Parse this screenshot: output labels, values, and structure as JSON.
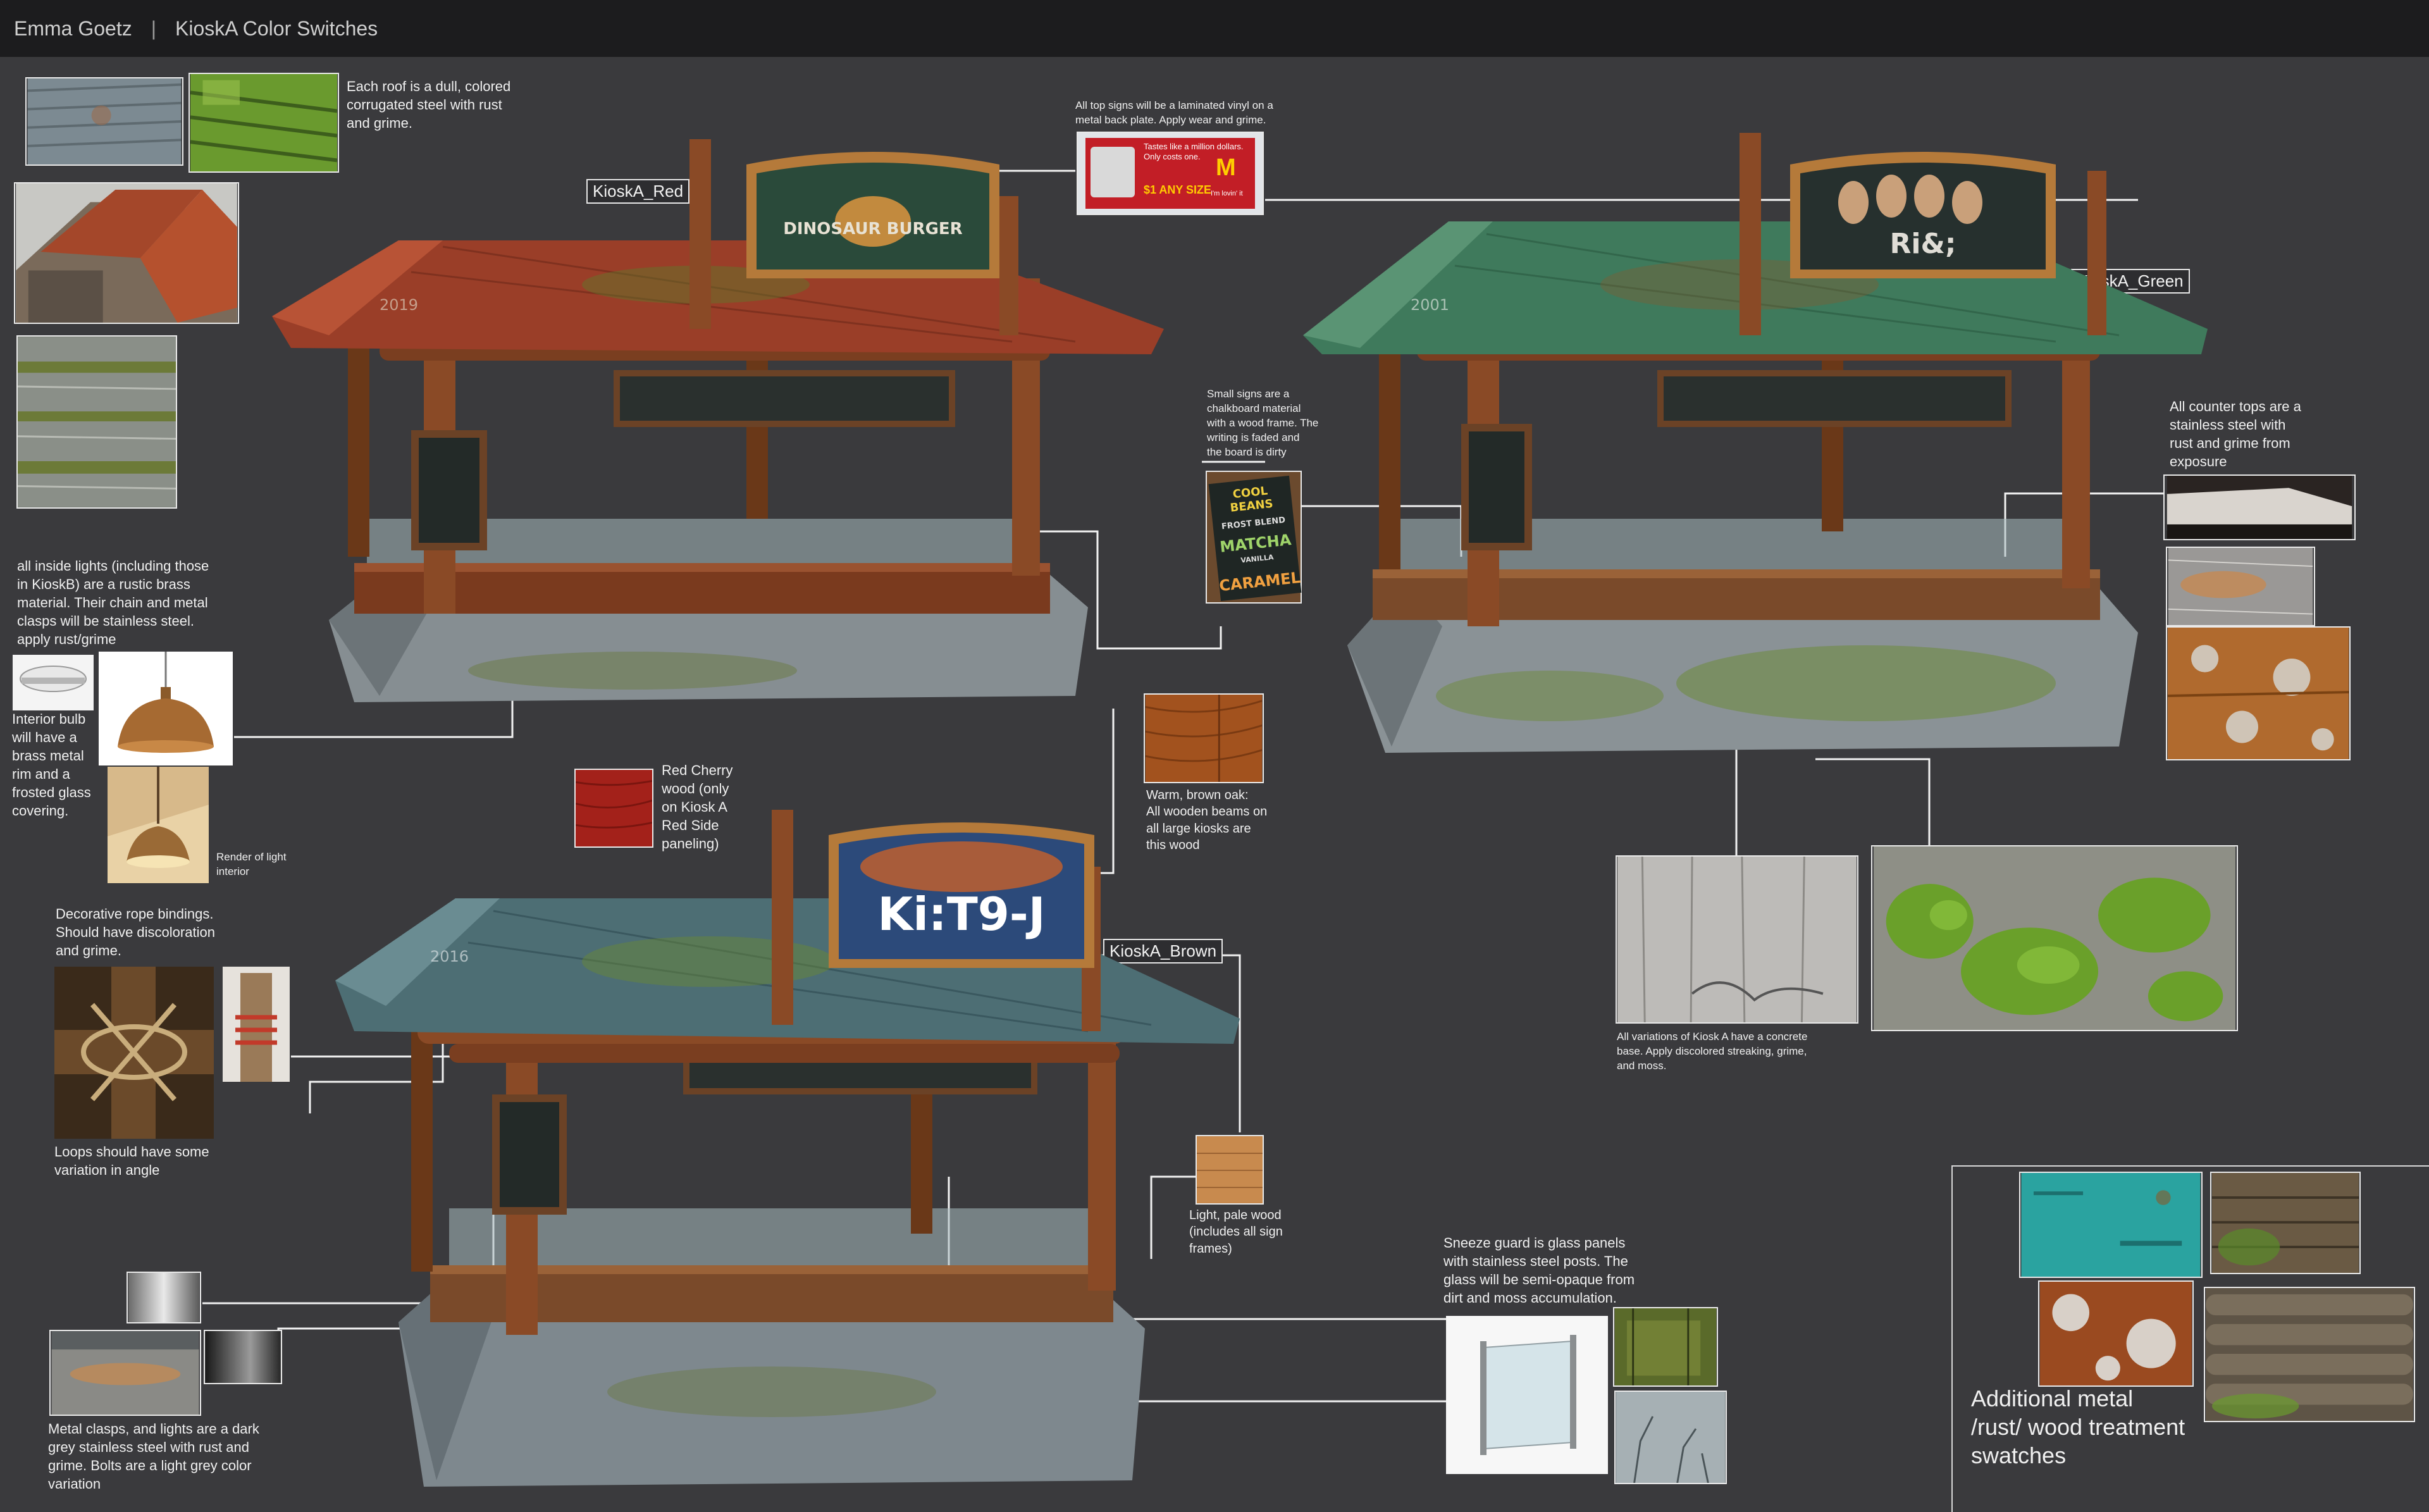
{
  "header": {
    "author": "Emma Goetz",
    "separator": "|",
    "title": "KioskA Color Switches"
  },
  "kiosk_labels": {
    "red": "KioskA_Red",
    "green": "KioskA_Green",
    "brown": "KioskA_Brown"
  },
  "notes": {
    "roof": "Each roof is a dull, colored\ncorrugated steel with rust\nand grime.",
    "top_signs": "All top signs will be a laminated vinyl on a\nmetal back plate. Apply wear and grime.",
    "inside_lights": "all inside lights (including those\nin KioskB) are a rustic brass\nmaterial. Their chain and metal\nclasps will be stainless steel.\napply rust/grime",
    "interior_bulb": "Interior bulb\nwill have a\nbrass metal\nrim and a\nfrosted glass\ncovering.",
    "render_light": "Render of light\ninterior",
    "red_cherry": "Red Cherry\nwood (only\non Kiosk A\nRed Side\npaneling)",
    "small_signs": "Small signs are a\nchalkboard material\nwith a wood frame. The\nwriting is faded and\nthe board is dirty",
    "brown_oak": "Warm, brown oak:\nAll wooden beams on\nall large kiosks are\nthis wood",
    "counter_tops": "All counter tops are a\nstainless steel with\nrust and grime from\nexposure",
    "concrete": "All variations of Kiosk A have a concrete\nbase. Apply discolored streaking, grime,\nand moss.",
    "rope": "Decorative rope bindings.\nShould have discoloration\nand grime.",
    "loops": "Loops should have some\nvariation in angle",
    "pale_wood": "Light, pale wood\n(includes all sign\nframes)",
    "sneeze_guard": "Sneeze guard is glass panels\nwith stainless steel posts. The\nglass will be semi-opaque from\ndirt and moss accumulation.",
    "metal_clasps": "Metal clasps, and lights are a dark\ngrey stainless steel with rust and\ngrime. Bolts are a light grey color\nvariation",
    "additional": "Additional metal\n/rust/ wood treatment\nswatches"
  },
  "billboard": {
    "line1": "Tastes like a million dollars.",
    "line2": "Only costs one.",
    "price": "$1 ANY SIZE",
    "sub": "I'm lovin' it"
  },
  "chalk_sign": {
    "l1": "COOL BEANS",
    "l2": "FROST BLEND",
    "l3": "MATCHA",
    "l4": "VANILLA",
    "l5": "CARAMEL"
  },
  "kiosk_signs": {
    "red": "DINOSAUR BURGER",
    "green": "Ri&;",
    "brown": "Ki:T9-J"
  },
  "years": {
    "red": "2019",
    "green": "2001",
    "brown": "2016"
  },
  "colors": {
    "background": "#3a3a3d",
    "topbar": "#1c1c1e",
    "red_roof": "#9a3e28",
    "green_roof": "#3f7a5c",
    "brown_roof": "#4d6e74",
    "wood": "#8a4a26",
    "pale_wood": "#c88a4e",
    "oak": "#a2521e",
    "cherry": "#a3211a",
    "concrete": "#8a9296",
    "teal_metal": "#2aa3a0"
  },
  "icons": [
    "ceiling-light-icon",
    "brass-pendant-lamp-icon",
    "glass-panel-icon"
  ]
}
